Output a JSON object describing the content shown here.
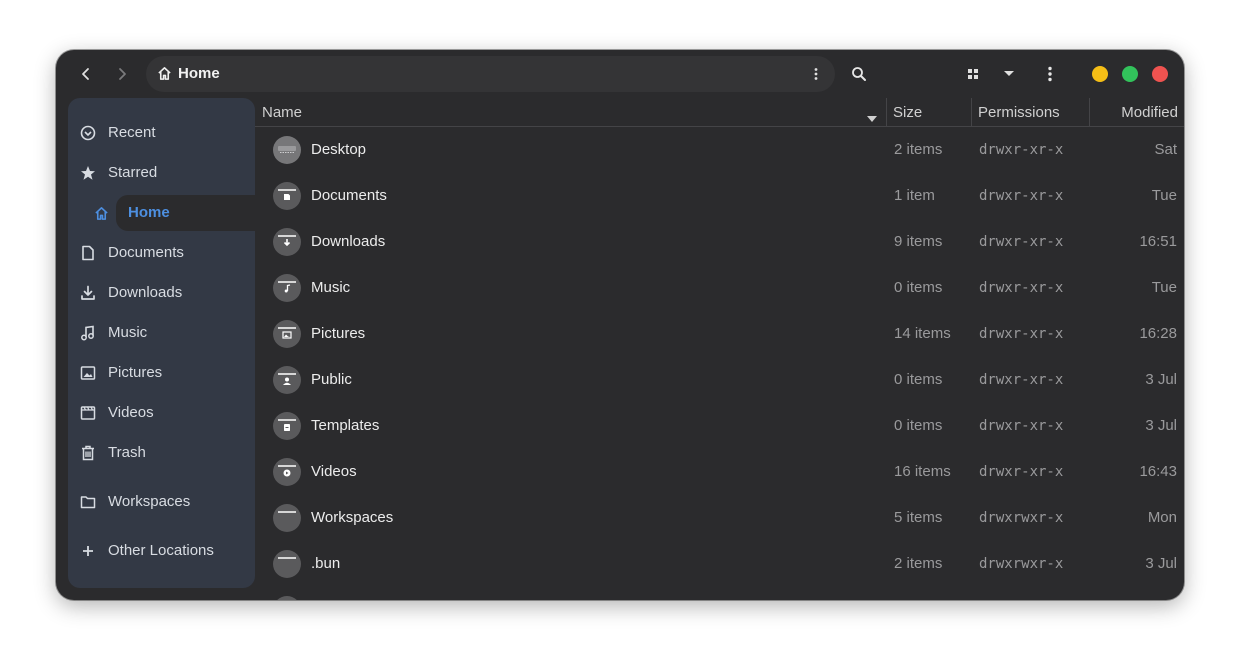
{
  "window": {
    "location": "Home",
    "traffic_lights": {
      "minimize": "#f5be16",
      "maximize": "#32c25b",
      "close": "#ef5350"
    }
  },
  "sidebar": {
    "items": [
      {
        "label": "Recent",
        "icon": "clock-icon"
      },
      {
        "label": "Starred",
        "icon": "star-icon"
      },
      {
        "label": "Home",
        "icon": "home-icon",
        "active": true
      },
      {
        "label": "Documents",
        "icon": "document-icon"
      },
      {
        "label": "Downloads",
        "icon": "download-icon"
      },
      {
        "label": "Music",
        "icon": "music-icon"
      },
      {
        "label": "Pictures",
        "icon": "picture-icon"
      },
      {
        "label": "Videos",
        "icon": "video-icon"
      },
      {
        "label": "Trash",
        "icon": "trash-icon"
      },
      {
        "label": "Workspaces",
        "icon": "folder-icon"
      },
      {
        "label": "Other Locations",
        "icon": "plus-icon"
      }
    ],
    "accent": "#4d8fe0"
  },
  "columns": {
    "name": "Name",
    "size": "Size",
    "permissions": "Permissions",
    "modified": "Modified"
  },
  "files": [
    {
      "name": "Desktop",
      "size": "2 items",
      "permissions": "drwxr-xr-x",
      "modified": "Sat",
      "icon": "desktop-folder-icon"
    },
    {
      "name": "Documents",
      "size": "1 item",
      "permissions": "drwxr-xr-x",
      "modified": "Tue",
      "icon": "documents-folder-icon"
    },
    {
      "name": "Downloads",
      "size": "9 items",
      "permissions": "drwxr-xr-x",
      "modified": "16:51",
      "icon": "downloads-folder-icon"
    },
    {
      "name": "Music",
      "size": "0 items",
      "permissions": "drwxr-xr-x",
      "modified": "Tue",
      "icon": "music-folder-icon"
    },
    {
      "name": "Pictures",
      "size": "14 items",
      "permissions": "drwxr-xr-x",
      "modified": "16:28",
      "icon": "pictures-folder-icon"
    },
    {
      "name": "Public",
      "size": "0 items",
      "permissions": "drwxr-xr-x",
      "modified": "3 Jul",
      "icon": "public-folder-icon"
    },
    {
      "name": "Templates",
      "size": "0 items",
      "permissions": "drwxr-xr-x",
      "modified": "3 Jul",
      "icon": "templates-folder-icon"
    },
    {
      "name": "Videos",
      "size": "16 items",
      "permissions": "drwxr-xr-x",
      "modified": "16:43",
      "icon": "videos-folder-icon"
    },
    {
      "name": "Workspaces",
      "size": "5 items",
      "permissions": "drwxrwxr-x",
      "modified": "Mon",
      "icon": "folder-icon"
    },
    {
      "name": ".bun",
      "size": "2 items",
      "permissions": "drwxrwxr-x",
      "modified": "3 Jul",
      "icon": "folder-icon"
    }
  ]
}
